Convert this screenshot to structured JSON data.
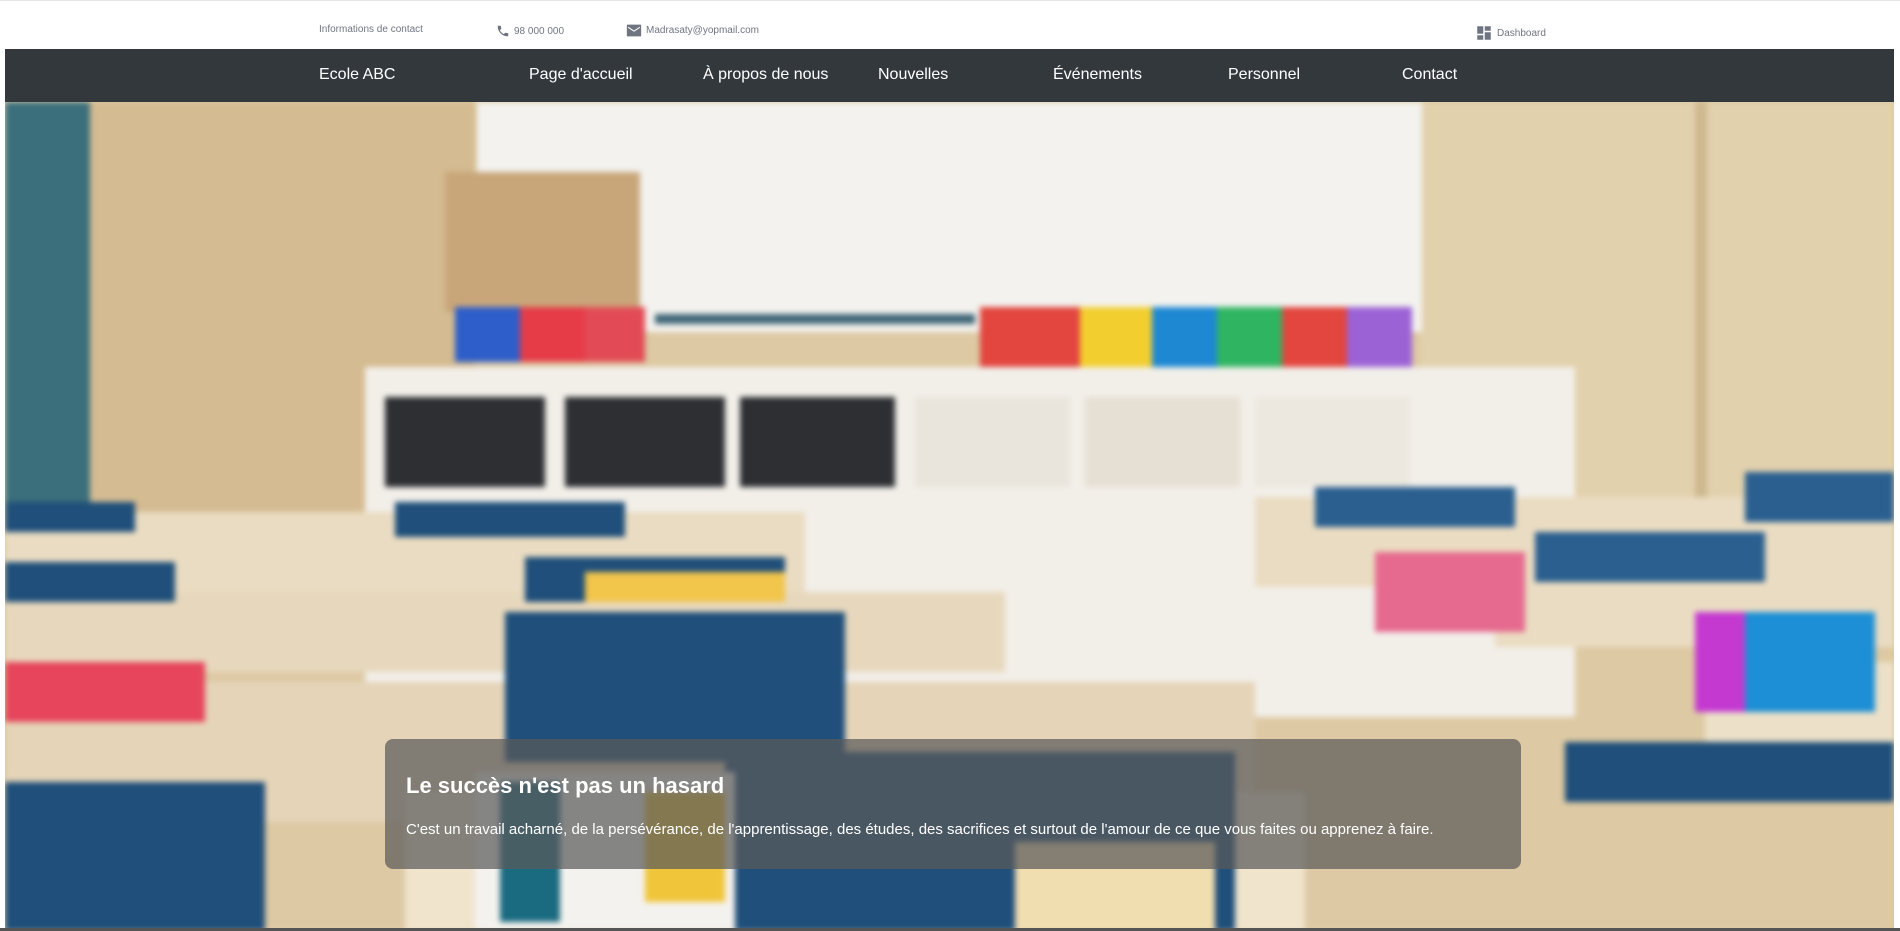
{
  "topbar": {
    "contact_label": "Informations de contact",
    "phone": "98 000 000",
    "email": "Madrasaty@yopmail.com",
    "dashboard_label": "Dashboard"
  },
  "navbar": {
    "brand": "Ecole ABC",
    "links": [
      "Page d'accueil",
      "À propos de nous",
      "Nouvelles",
      "Événements",
      "Personnel",
      "Contact"
    ]
  },
  "hero": {
    "title": "Le succès n'est pas un hasard",
    "text": "C'est un travail acharné, de la persévérance, de l'apprentissage, des études, des sacrifices et surtout de l'amour de ce que vous faites ou apprenez à faire."
  },
  "colors": {
    "navbar_bg": "#33383d",
    "topbar_text": "#6f7580",
    "caption_bg": "rgba(90,90,90,0.72)"
  },
  "icons": {
    "phone": "phone-icon",
    "email": "mail-icon",
    "dashboard": "dashboard-icon"
  }
}
